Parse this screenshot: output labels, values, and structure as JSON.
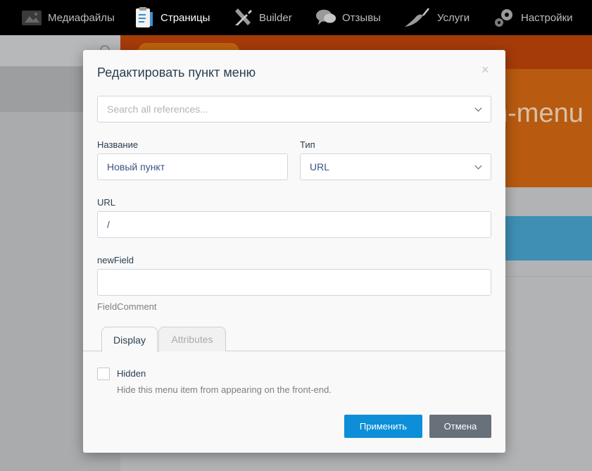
{
  "nav": {
    "items": [
      {
        "label": "Медиафайлы",
        "icon": "media-icon"
      },
      {
        "label": "Страницы",
        "icon": "pages-icon"
      },
      {
        "label": "Builder",
        "icon": "builder-icon"
      },
      {
        "label": "Отзывы",
        "icon": "reviews-icon"
      },
      {
        "label": "Услуги",
        "icon": "services-icon"
      },
      {
        "label": "Настройки",
        "icon": "settings-icon"
      }
    ],
    "active": "Страницы"
  },
  "background": {
    "banner_text": "n-menu"
  },
  "modal": {
    "title": "Редактировать пункт меню",
    "close": "×",
    "reference_search": {
      "placeholder": "Search all references..."
    },
    "name": {
      "label": "Название",
      "value": "Новый пункт"
    },
    "type": {
      "label": "Тип",
      "value": "URL"
    },
    "url": {
      "label": "URL",
      "value": "/"
    },
    "new_field": {
      "label": "newField",
      "value": "",
      "comment": "FieldComment"
    },
    "tabs": [
      {
        "label": "Display",
        "active": true
      },
      {
        "label": "Attributes",
        "active": false
      }
    ],
    "hidden": {
      "label": "Hidden",
      "checked": false,
      "help": "Hide this menu item from appearing on the front-end."
    },
    "apply_label": "Применить",
    "cancel_label": "Отмена"
  },
  "colors": {
    "accent": "#0c8fd8",
    "cancel": "#68707a",
    "banner": "#e0741a"
  }
}
